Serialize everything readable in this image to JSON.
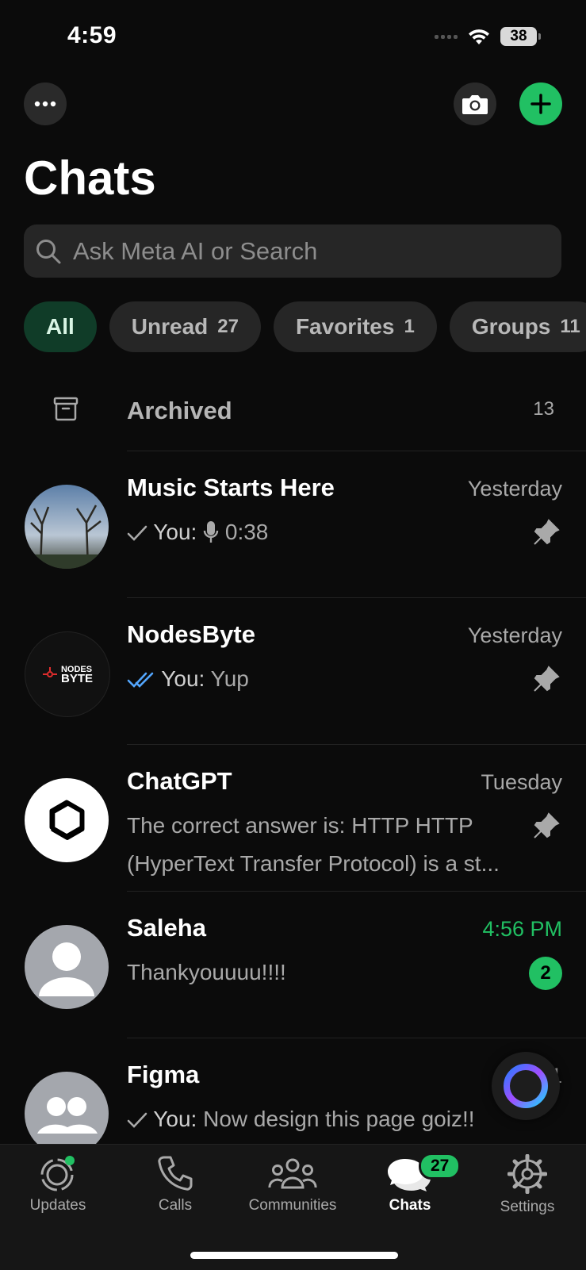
{
  "status_bar": {
    "time": "4:59",
    "battery": "38"
  },
  "header": {
    "title": "Chats"
  },
  "search": {
    "placeholder": "Ask Meta AI or Search"
  },
  "filters": [
    {
      "label": "All",
      "count": ""
    },
    {
      "label": "Unread",
      "count": "27"
    },
    {
      "label": "Favorites",
      "count": "1"
    },
    {
      "label": "Groups",
      "count": "11"
    }
  ],
  "archived": {
    "label": "Archived",
    "count": "13"
  },
  "chats": [
    {
      "name": "Music Starts Here",
      "time": "Yesterday",
      "prefix": "You:",
      "preview": "0:38"
    },
    {
      "name": "NodesByte",
      "time": "Yesterday",
      "prefix": "You:",
      "preview": "Yup",
      "avatar_text_1": "NODES",
      "avatar_text_2": "BYTE"
    },
    {
      "name": "ChatGPT",
      "time": "Tuesday",
      "preview": "The correct answer is: HTTP   HTTP (HyperText Transfer Protocol) is a st..."
    },
    {
      "name": "Saleha",
      "time": "4:56 PM",
      "preview": "Thankyouuuu!!!!",
      "unread": "2"
    },
    {
      "name": "Figma",
      "time": "4:51",
      "prefix": "You:",
      "preview": "Now design this page goiz!!"
    }
  ],
  "tabs": [
    {
      "label": "Updates"
    },
    {
      "label": "Calls"
    },
    {
      "label": "Communities"
    },
    {
      "label": "Chats",
      "badge": "27"
    },
    {
      "label": "Settings"
    }
  ],
  "colors": {
    "accent": "#21c063",
    "background": "#0b0b0b",
    "read_ticks": "#53a6fd"
  }
}
